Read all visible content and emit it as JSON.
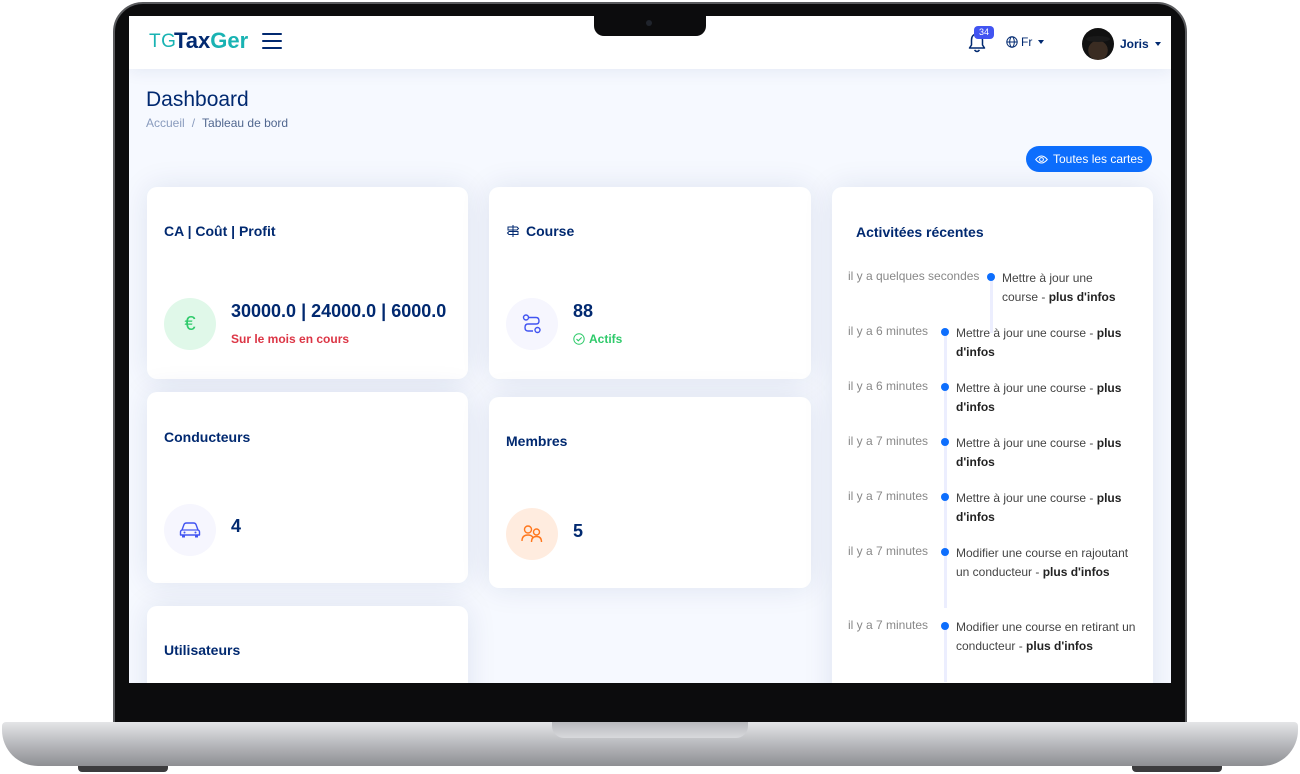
{
  "header": {
    "logo_mark": "TG",
    "logo_text_main": "Tax",
    "logo_text_accent": "Ger",
    "notification_count": "34",
    "language": "Fr",
    "user_name": "Joris"
  },
  "page": {
    "title": "Dashboard",
    "breadcrumb": {
      "home": "Accueil",
      "separator": "/",
      "current": "Tableau de bord"
    },
    "all_cards_button": "Toutes les cartes"
  },
  "cards": {
    "ca": {
      "title": "CA | Coût | Profit",
      "value": "30000.0 | 24000.0 | 6000.0",
      "sub": "Sur le mois en cours",
      "icon": "euro-icon"
    },
    "course": {
      "title": "Course",
      "value": "88",
      "sub": "Actifs",
      "icon": "route-icon"
    },
    "conducteurs": {
      "title": "Conducteurs",
      "value": "4",
      "icon": "car-icon"
    },
    "membres": {
      "title": "Membres",
      "value": "5",
      "icon": "people-icon"
    },
    "utilisateurs": {
      "title": "Utilisateurs"
    }
  },
  "activity": {
    "title": "Activitées récentes",
    "more_label": "plus d'infos",
    "items": [
      {
        "time": "il y a quelques secondes",
        "text": "Mettre à jour une course - "
      },
      {
        "time": "il y a 6 minutes",
        "text": "Mettre à jour une course - "
      },
      {
        "time": "il y a 6 minutes",
        "text": "Mettre à jour une course - "
      },
      {
        "time": "il y a 7 minutes",
        "text": "Mettre à jour une course - "
      },
      {
        "time": "il y a 7 minutes",
        "text": "Mettre à jour une course - "
      },
      {
        "time": "il y a 7 minutes",
        "text": "Modifier une course en rajoutant un conducteur - "
      },
      {
        "time": "il y a 7 minutes",
        "text": "Modifier une course en retirant un conducteur - "
      }
    ]
  },
  "colors": {
    "primary": "#0d6efd",
    "navy": "#012970",
    "teal": "#19b3b3",
    "danger": "#dc3545",
    "success": "#2eca6a",
    "orange": "#ff771d",
    "screen_bg": "#f6f9ff"
  }
}
